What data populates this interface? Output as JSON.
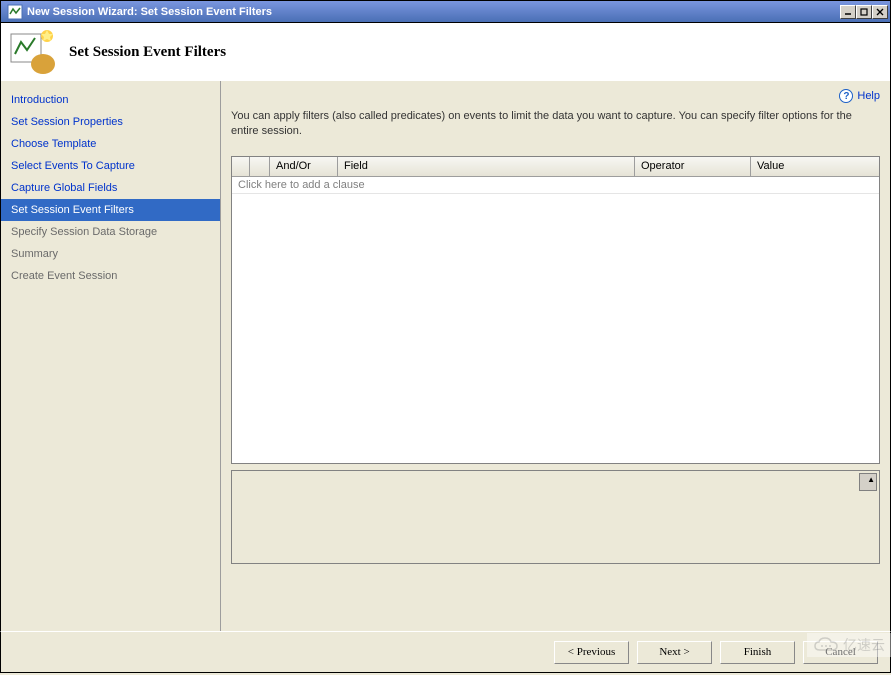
{
  "window": {
    "title": "New Session Wizard: Set Session Event Filters"
  },
  "header": {
    "title": "Set Session Event Filters"
  },
  "sidebar": {
    "items": [
      {
        "label": "Introduction",
        "state": "link"
      },
      {
        "label": "Set Session Properties",
        "state": "link"
      },
      {
        "label": "Choose Template",
        "state": "link"
      },
      {
        "label": "Select Events To Capture",
        "state": "link"
      },
      {
        "label": "Capture Global Fields",
        "state": "link"
      },
      {
        "label": "Set Session Event Filters",
        "state": "active"
      },
      {
        "label": "Specify Session Data Storage",
        "state": "disabled"
      },
      {
        "label": "Summary",
        "state": "disabled"
      },
      {
        "label": "Create Event Session",
        "state": "disabled"
      }
    ]
  },
  "main": {
    "help": "Help",
    "description": "You can apply filters (also called predicates) on events to limit the data you want to capture. You can specify filter options for the entire session.",
    "grid": {
      "columns": {
        "andor": "And/Or",
        "field": "Field",
        "operator": "Operator",
        "value": "Value"
      },
      "placeholder_row": "Click here to add a clause"
    }
  },
  "footer": {
    "previous": "< Previous",
    "next": "Next >",
    "finish": "Finish",
    "cancel": "Cancel"
  },
  "watermark": "亿速云"
}
